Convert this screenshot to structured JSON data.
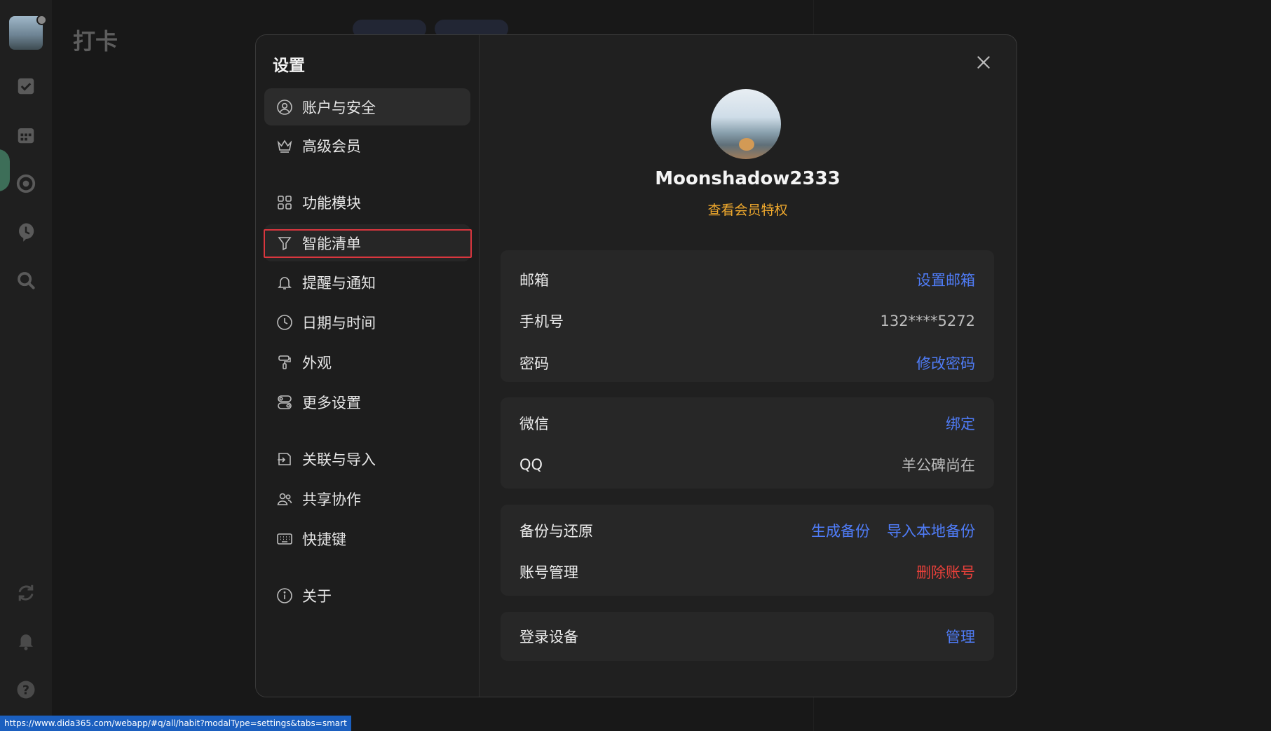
{
  "background": {
    "page_title": "打卡"
  },
  "modal": {
    "title": "设置",
    "nav": [
      {
        "label": "账户与安全",
        "icon": "user-circle-icon"
      },
      {
        "label": "高级会员",
        "icon": "crown-icon"
      },
      {
        "label": "功能模块",
        "icon": "grid-icon"
      },
      {
        "label": "智能清单",
        "icon": "filter-icon"
      },
      {
        "label": "提醒与通知",
        "icon": "bell-icon"
      },
      {
        "label": "日期与时间",
        "icon": "clock-icon"
      },
      {
        "label": "外观",
        "icon": "paint-roller-icon"
      },
      {
        "label": "更多设置",
        "icon": "toggles-icon"
      },
      {
        "label": "关联与导入",
        "icon": "import-icon"
      },
      {
        "label": "共享协作",
        "icon": "users-icon"
      },
      {
        "label": "快捷键",
        "icon": "keyboard-icon"
      },
      {
        "label": "关于",
        "icon": "info-icon"
      }
    ],
    "profile": {
      "username": "Moonshadow2333",
      "vip_link": "查看会员特权"
    },
    "account": {
      "email_label": "邮箱",
      "email_action": "设置邮箱",
      "phone_label": "手机号",
      "phone_value": "132****5272",
      "password_label": "密码",
      "password_action": "修改密码"
    },
    "social": {
      "wechat_label": "微信",
      "wechat_action": "绑定",
      "qq_label": "QQ",
      "qq_value": "羊公碑尚在"
    },
    "data": {
      "backup_label": "备份与还原",
      "backup_action": "生成备份",
      "import_action": "导入本地备份",
      "manage_label": "账号管理",
      "delete_action": "删除账号"
    },
    "devices": {
      "label": "登录设备",
      "action": "管理"
    }
  },
  "status_url": "https://www.dida365.com/webapp/#q/all/habit?modalType=settings&tabs=smart",
  "colors": {
    "link": "#4f7cf7",
    "vip": "#f0a92d",
    "danger": "#e8403a",
    "highlight_box": "#d9363e"
  }
}
